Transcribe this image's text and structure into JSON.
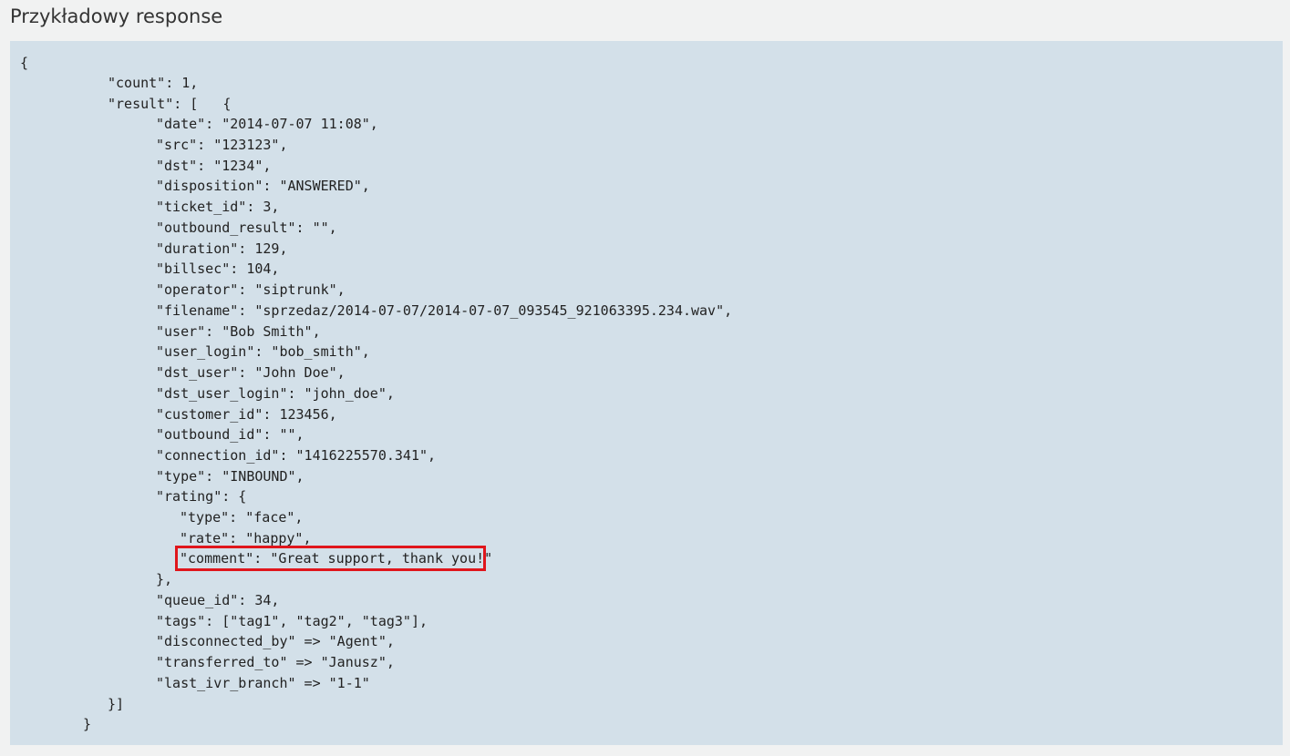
{
  "section": {
    "title": "Przykładowy response"
  },
  "code": {
    "lines": [
      "{",
      "\"count\": 1,",
      "\"result\": [   {",
      "\"date\": \"2014-07-07 11:08\",",
      "\"src\": \"123123\",",
      "\"dst\": \"1234\",",
      "\"disposition\": \"ANSWERED\",",
      "\"ticket_id\": 3,",
      "\"outbound_result\": \"\",",
      "\"duration\": 129,",
      "\"billsec\": 104,",
      "\"operator\": \"siptrunk\",",
      "\"filename\": \"sprzedaz/2014-07-07/2014-07-07_093545_921063395.234.wav\",",
      "\"user\": \"Bob Smith\",",
      "\"user_login\": \"bob_smith\",",
      "\"dst_user\": \"John Doe\",",
      "\"dst_user_login\": \"john_doe\",",
      "\"customer_id\": 123456,",
      "\"outbound_id\": \"\",",
      "\"connection_id\": \"1416225570.341\",",
      "\"type\": \"INBOUND\",",
      "\"rating\": {",
      "\"type\": \"face\",",
      "\"rate\": \"happy\",",
      "\"comment\": \"Great support, thank you!\"",
      "},",
      "\"queue_id\": 34,",
      "\"tags\": [\"tag1\", \"tag2\", \"tag3\"],",
      "\"disconnected_by\" => \"Agent\",",
      "\"transferred_to\" => \"Janusz\",",
      "\"last_ivr_branch\" => \"1-1\"",
      "}]",
      "}"
    ]
  },
  "highlight": {
    "color": "#e0161c"
  },
  "colors": {
    "page_background": "#f1f2f2",
    "code_background": "#d3e0e9",
    "text": "#222222"
  }
}
